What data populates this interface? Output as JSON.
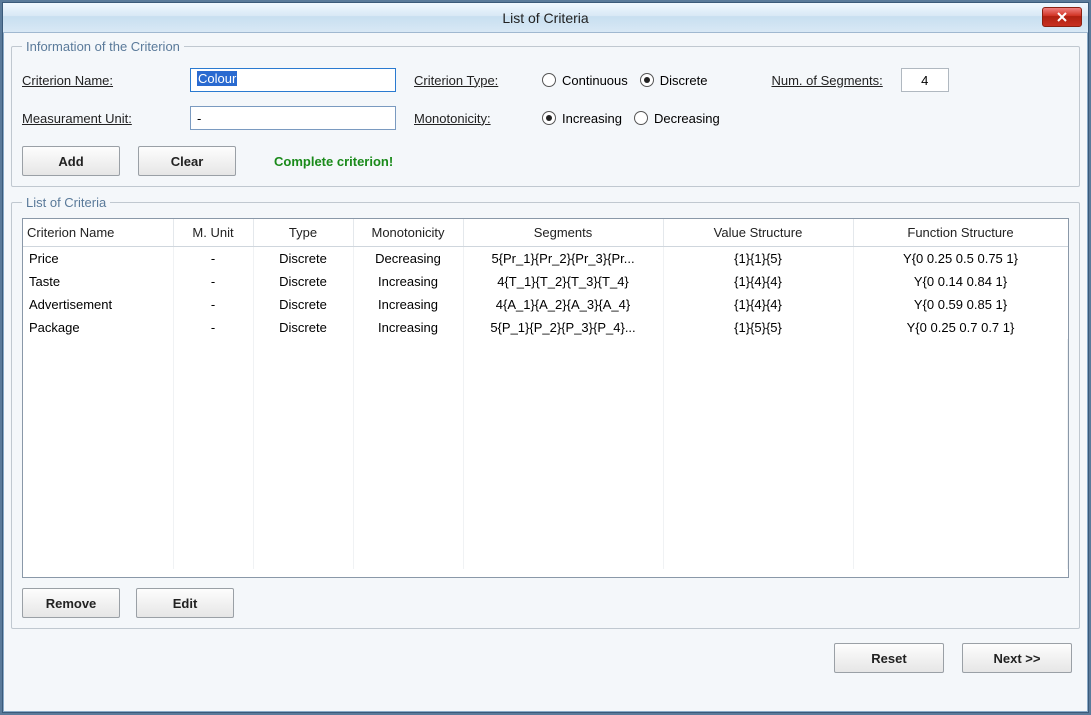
{
  "window": {
    "title": "List of Criteria"
  },
  "info_group": {
    "legend": "Information of the Criterion",
    "criterion_name_label": "Criterion Name:",
    "criterion_name_value": "Colour",
    "criterion_type_label": "Criterion Type:",
    "continuous_label": "Continuous",
    "discrete_label": "Discrete",
    "num_segments_label": "Num. of Segments:",
    "num_segments_value": "4",
    "measurement_unit_label": "Measurament Unit:",
    "measurement_unit_value": "-",
    "monotonicity_label": "Monotonicity:",
    "increasing_label": "Increasing",
    "decreasing_label": "Decreasing",
    "add_label": "Add",
    "clear_label": "Clear",
    "status_text": "Complete criterion!"
  },
  "list_group": {
    "legend": "List of Criteria",
    "columns": {
      "name": "Criterion Name",
      "unit": "M. Unit",
      "type": "Type",
      "mono": "Monotonicity",
      "seg": "Segments",
      "val": "Value Structure",
      "func": "Function Structure"
    },
    "rows": [
      {
        "name": "Price",
        "unit": "-",
        "type": "Discrete",
        "mono": "Decreasing",
        "seg": "5{Pr_1}{Pr_2}{Pr_3}{Pr...",
        "val": "{1}{1}{5}",
        "func": "Y{0 0.25 0.5 0.75 1}"
      },
      {
        "name": "Taste",
        "unit": "-",
        "type": "Discrete",
        "mono": "Increasing",
        "seg": "4{T_1}{T_2}{T_3}{T_4}",
        "val": "{1}{4}{4}",
        "func": "Y{0 0.14 0.84 1}"
      },
      {
        "name": "Advertisement",
        "unit": "-",
        "type": "Discrete",
        "mono": "Increasing",
        "seg": "4{A_1}{A_2}{A_3}{A_4}",
        "val": "{1}{4}{4}",
        "func": "Y{0 0.59 0.85 1}"
      },
      {
        "name": "Package",
        "unit": "-",
        "type": "Discrete",
        "mono": "Increasing",
        "seg": "5{P_1}{P_2}{P_3}{P_4}...",
        "val": "{1}{5}{5}",
        "func": "Y{0 0.25 0.7 0.7 1}"
      }
    ],
    "remove_label": "Remove",
    "edit_label": "Edit"
  },
  "footer": {
    "reset_label": "Reset",
    "next_label": "Next >>"
  }
}
